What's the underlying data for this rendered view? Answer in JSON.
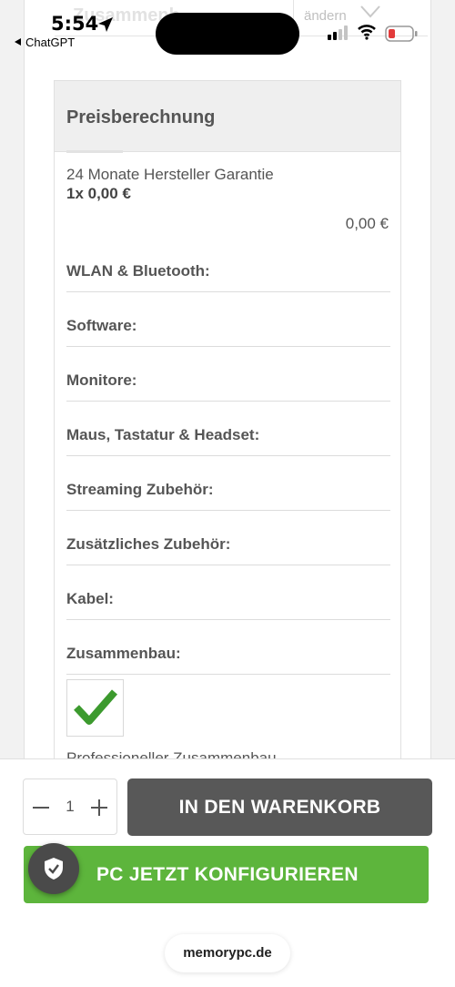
{
  "status_bar": {
    "time": "5:54",
    "back_app": "ChatGPT"
  },
  "top_row": {
    "label": "Zusammenb",
    "change_label": "ändern"
  },
  "price_panel": {
    "title": "Preisberechnung",
    "warranty": {
      "name": "24 Monate Hersteller Garantie",
      "quantity_price": "1x 0,00 €",
      "total": "0,00 €"
    },
    "categories": [
      "WLAN & Bluetooth:",
      "Software:",
      "Monitore:",
      "Maus, Tastatur & Headset:",
      "Streaming Zubehör:",
      "Zusätzliches Zubehör:",
      "Kabel:",
      "Zusammenbau:"
    ],
    "assembly_item": "Professioneller Zusammenbau"
  },
  "bottom_bar": {
    "quantity": "1",
    "cart_button": "IN DEN WARENKORB",
    "configure_button": "PC JETZT KONFIGURIEREN",
    "domain": "memorypc.de"
  },
  "colors": {
    "green": "#5db53c",
    "dark_button": "#585858",
    "checkmark": "#3c9a2e"
  },
  "icons": {
    "location": "location-arrow-icon",
    "shield": "shield-check-icon",
    "check": "checkmark-icon"
  }
}
